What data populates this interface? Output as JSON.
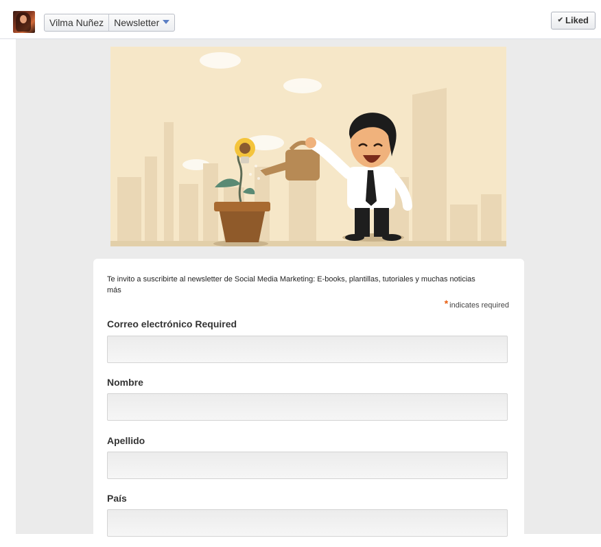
{
  "header": {
    "owner_name": "Vilma Nuñez",
    "tab_name": "Newsletter",
    "liked_label": "Liked"
  },
  "form": {
    "intro": "Te invito a suscribirte al newsletter de Social Media Marketing: E-books, plantillas, tutoriales y muchas noticias más",
    "required_star": "*",
    "required_note": "indicates required",
    "fields": [
      {
        "label": "Correo electrónico Required",
        "value": ""
      },
      {
        "label": "Nombre",
        "value": ""
      },
      {
        "label": "Apellido",
        "value": ""
      },
      {
        "label": "País",
        "value": ""
      }
    ]
  },
  "colors": {
    "banner_bg": "#f6e7c8",
    "required_star": "#e85c0d",
    "canvas_bg": "#ebebeb"
  }
}
